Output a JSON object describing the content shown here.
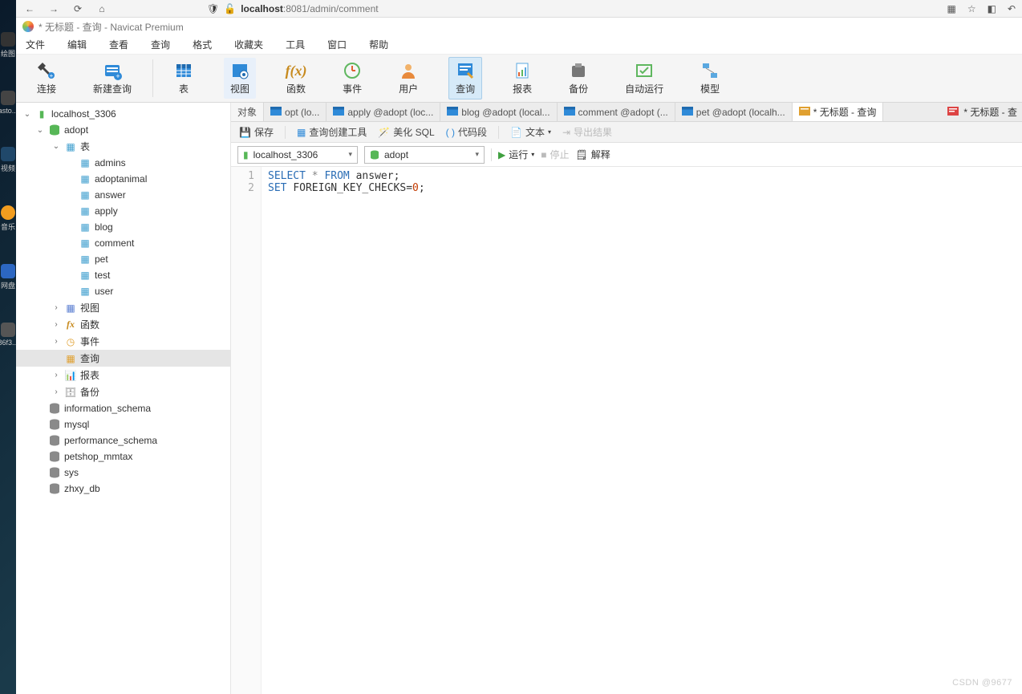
{
  "browser": {
    "url_host": "localhost",
    "url_rest": ":8081/admin/comment"
  },
  "window_title": "* 无标题 - 查询 - Navicat Premium",
  "menu": [
    "文件",
    "编辑",
    "查看",
    "查询",
    "格式",
    "收藏夹",
    "工具",
    "窗口",
    "帮助"
  ],
  "toolbar_groups": [
    [
      {
        "id": "connect",
        "label": "连接",
        "icon": "plug"
      },
      {
        "id": "new-query",
        "label": "新建查询",
        "icon": "newquery"
      }
    ],
    [
      {
        "id": "table",
        "label": "表",
        "icon": "table"
      },
      {
        "id": "view",
        "label": "视图",
        "icon": "view",
        "active": false
      },
      {
        "id": "function",
        "label": "函数",
        "icon": "fx"
      },
      {
        "id": "event",
        "label": "事件",
        "icon": "clock"
      },
      {
        "id": "user",
        "label": "用户",
        "icon": "user"
      },
      {
        "id": "query",
        "label": "查询",
        "icon": "query",
        "active": true
      },
      {
        "id": "report",
        "label": "报表",
        "icon": "report"
      },
      {
        "id": "backup",
        "label": "备份",
        "icon": "backup"
      },
      {
        "id": "automation",
        "label": "自动运行",
        "icon": "automation"
      },
      {
        "id": "model",
        "label": "模型",
        "icon": "model"
      }
    ]
  ],
  "tree": {
    "connection": {
      "label": "localhost_3306"
    },
    "active_db": {
      "label": "adopt"
    },
    "table_folder": "表",
    "tables": [
      "admins",
      "adoptanimal",
      "answer",
      "apply",
      "blog",
      "comment",
      "pet",
      "test",
      "user"
    ],
    "folders": [
      {
        "id": "view",
        "label": "视图",
        "icon": "view"
      },
      {
        "id": "fx",
        "label": "函数",
        "icon": "fx"
      },
      {
        "id": "event",
        "label": "事件",
        "icon": "event"
      },
      {
        "id": "query",
        "label": "查询",
        "icon": "query",
        "selected": true
      },
      {
        "id": "report",
        "label": "报表",
        "icon": "report"
      },
      {
        "id": "backup",
        "label": "备份",
        "icon": "backup"
      }
    ],
    "other_dbs": [
      "information_schema",
      "mysql",
      "performance_schema",
      "petshop_mmtax",
      "sys",
      "zhxy_db"
    ]
  },
  "tabs": [
    {
      "id": "objects",
      "label": "对象",
      "icon": "none",
      "first": true
    },
    {
      "id": "t1",
      "label": "opt (lo...",
      "icon": "table"
    },
    {
      "id": "t2",
      "label": "apply @adopt (loc...",
      "icon": "table"
    },
    {
      "id": "t3",
      "label": "blog @adopt (local...",
      "icon": "table"
    },
    {
      "id": "t4",
      "label": "comment @adopt (...",
      "icon": "table"
    },
    {
      "id": "t5",
      "label": "pet @adopt (localh...",
      "icon": "table"
    },
    {
      "id": "t6",
      "label": "* 无标题 - 查询",
      "icon": "query"
    }
  ],
  "tab_overflow": {
    "icon": "query-red",
    "label": "* 无标题 - 查"
  },
  "subtoolbar": {
    "save": "保存",
    "builder": "查询创建工具",
    "beautify": "美化 SQL",
    "snippet": "代码段",
    "text": "文本",
    "export": "导出结果"
  },
  "connbar": {
    "server": "localhost_3306",
    "db": "adopt",
    "run": "运行",
    "stop": "停止",
    "explain": "解释"
  },
  "editor": {
    "lines": [
      "1",
      "2"
    ],
    "line1": {
      "kw1": "SELECT",
      "star": "*",
      "kw2": "FROM",
      "ident": "answer",
      "sem": ";"
    },
    "line2": {
      "kw1": "SET",
      "ident": "FOREIGN_KEY_CHECKS",
      "eq": "=",
      "num": "0",
      "sem": ";"
    }
  },
  "desktop_labels": [
    "绘图",
    "asto...",
    "视频",
    "音乐",
    "网盘",
    "86f3..."
  ],
  "watermark": "CSDN @9677"
}
